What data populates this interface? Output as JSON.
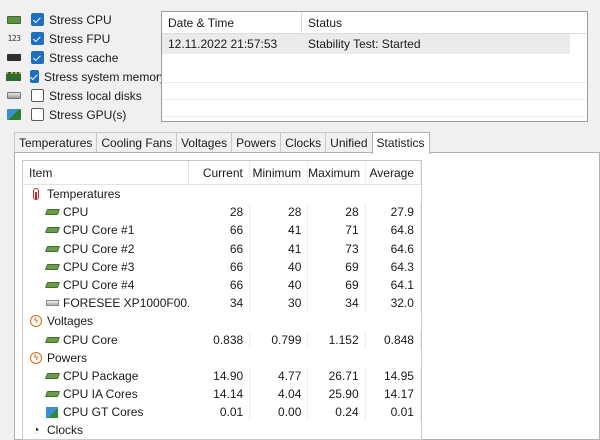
{
  "stress_options": [
    {
      "label": "Stress CPU",
      "checked": true,
      "icon": "cpu-chip-icon"
    },
    {
      "label": "Stress FPU",
      "checked": true,
      "icon": "fpu-123-icon"
    },
    {
      "label": "Stress cache",
      "checked": true,
      "icon": "cache-chip-icon"
    },
    {
      "label": "Stress system memory",
      "checked": true,
      "icon": "memory-module-icon"
    },
    {
      "label": "Stress local disks",
      "checked": false,
      "icon": "disk-drive-icon"
    },
    {
      "label": "Stress GPU(s)",
      "checked": false,
      "icon": "gpu-icon"
    }
  ],
  "fpu_icon_text": "123",
  "log": {
    "headers": {
      "date_time": "Date & Time",
      "status": "Status"
    },
    "rows": [
      {
        "date_time": "12.11.2022 21:57:53",
        "status": "Stability Test: Started"
      }
    ]
  },
  "tabs": [
    {
      "label": "Temperatures",
      "active": false
    },
    {
      "label": "Cooling Fans",
      "active": false
    },
    {
      "label": "Voltages",
      "active": false
    },
    {
      "label": "Powers",
      "active": false
    },
    {
      "label": "Clocks",
      "active": false
    },
    {
      "label": "Unified",
      "active": false
    },
    {
      "label": "Statistics",
      "active": true
    }
  ],
  "stats": {
    "headers": {
      "item": "Item",
      "current": "Current",
      "minimum": "Minimum",
      "maximum": "Maximum",
      "average": "Average"
    },
    "groups": {
      "temperatures": {
        "label": "Temperatures",
        "rows": [
          {
            "item": "CPU",
            "current": "28",
            "minimum": "28",
            "maximum": "28",
            "average": "27.9"
          },
          {
            "item": "CPU Core #1",
            "current": "66",
            "minimum": "41",
            "maximum": "71",
            "average": "64.8"
          },
          {
            "item": "CPU Core #2",
            "current": "66",
            "minimum": "41",
            "maximum": "73",
            "average": "64.6"
          },
          {
            "item": "CPU Core #3",
            "current": "66",
            "minimum": "40",
            "maximum": "69",
            "average": "64.3"
          },
          {
            "item": "CPU Core #4",
            "current": "66",
            "minimum": "40",
            "maximum": "69",
            "average": "64.1"
          },
          {
            "item": "FORESEE XP1000F00...",
            "current": "34",
            "minimum": "30",
            "maximum": "34",
            "average": "32.0"
          }
        ]
      },
      "voltages": {
        "label": "Voltages",
        "rows": [
          {
            "item": "CPU Core",
            "current": "0.838",
            "minimum": "0.799",
            "maximum": "1.152",
            "average": "0.848"
          }
        ]
      },
      "powers": {
        "label": "Powers",
        "rows": [
          {
            "item": "CPU Package",
            "current": "14.90",
            "minimum": "4.77",
            "maximum": "26.71",
            "average": "14.95"
          },
          {
            "item": "CPU IA Cores",
            "current": "14.14",
            "minimum": "4.04",
            "maximum": "25.90",
            "average": "14.17"
          },
          {
            "item": "CPU GT Cores",
            "current": "0.01",
            "minimum": "0.00",
            "maximum": "0.24",
            "average": "0.01"
          }
        ]
      },
      "clocks": {
        "label": "Clocks"
      }
    }
  }
}
